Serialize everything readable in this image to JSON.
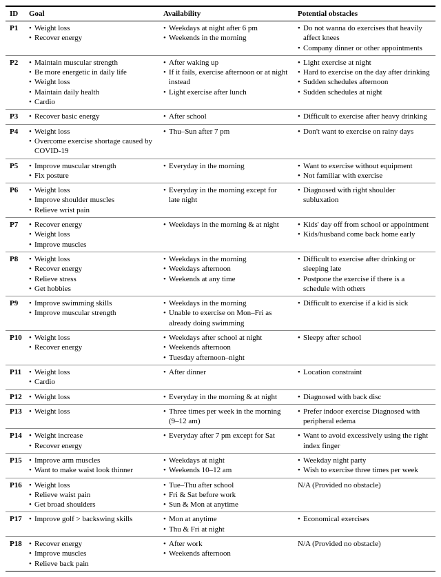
{
  "headers": {
    "id": "ID",
    "goal": "Goal",
    "availability": "Availability",
    "obstacles": "Potential obstacles"
  },
  "rows": [
    {
      "id": "P1",
      "goal": [
        "Weight loss",
        "Recover energy"
      ],
      "availability": [
        "Weekdays at night after 6 pm",
        "Weekends in the morning"
      ],
      "obstacles": [
        "Do not wanna do exercises that heavily affect knees",
        "Company dinner or other appointments"
      ]
    },
    {
      "id": "P2",
      "goal": [
        "Maintain muscular strength",
        "Be more energetic in daily life",
        "Weight loss",
        "Maintain daily health",
        "Cardio"
      ],
      "availability": [
        "After waking up",
        "If it fails, exercise afternoon or at night instead",
        "Light exercise after lunch"
      ],
      "obstacles": [
        "Light exercise at night",
        "Hard to exercise on the day after drinking",
        "Sudden schedules afternoon",
        "Sudden schedules at night"
      ]
    },
    {
      "id": "P3",
      "goal": [
        "Recover basic energy"
      ],
      "availability": [
        "After school"
      ],
      "obstacles": [
        "Difficult to exercise after heavy drinking"
      ]
    },
    {
      "id": "P4",
      "goal": [
        "Weight loss",
        "Overcome exercise shortage caused by COVID-19"
      ],
      "availability": [
        "Thu–Sun after 7 pm"
      ],
      "obstacles": [
        "Don't want to exercise on rainy days"
      ]
    },
    {
      "id": "P5",
      "goal": [
        "Improve muscular strength",
        "Fix posture"
      ],
      "availability": [
        "Everyday in the morning"
      ],
      "obstacles": [
        "Want to exercise without equipment",
        "Not familiar with exercise"
      ]
    },
    {
      "id": "P6",
      "goal": [
        "Weight loss",
        "Improve shoulder muscles",
        "Relieve wrist pain"
      ],
      "availability": [
        "Everyday in the morning except for late night"
      ],
      "obstacles": [
        "Diagnosed with right shoulder subluxation"
      ]
    },
    {
      "id": "P7",
      "goal": [
        "Recover energy",
        "Weight loss",
        "Improve muscles"
      ],
      "availability": [
        "Weekdays in the morning & at night"
      ],
      "obstacles": [
        "Kids' day off from school or appointment",
        "Kids/husband come back home early"
      ]
    },
    {
      "id": "P8",
      "goal": [
        "Weight loss",
        "Recover energy",
        "Relieve stress",
        "Get hobbies"
      ],
      "availability": [
        "Weekdays in the morning",
        "Weekdays afternoon",
        "Weekends at any time"
      ],
      "obstacles": [
        "Difficult to exercise after drinking or sleeping late",
        "Postpone the exercise if there is a schedule with others"
      ]
    },
    {
      "id": "P9",
      "goal": [
        "Improve swimming skills",
        "Improve muscular strength"
      ],
      "availability": [
        "Weekdays in the morning",
        "Unable to exercise on Mon–Fri as already doing swimming"
      ],
      "obstacles": [
        "Difficult to exercise if a kid is sick"
      ]
    },
    {
      "id": "P10",
      "goal": [
        "Weight loss",
        "Recover energy"
      ],
      "availability": [
        "Weekdays after school at night",
        "Weekends afternoon",
        "Tuesday afternoon–night"
      ],
      "obstacles": [
        "Sleepy after school"
      ]
    },
    {
      "id": "P11",
      "goal": [
        "Weight loss",
        "Cardio"
      ],
      "availability": [
        "After dinner"
      ],
      "obstacles": [
        "Location constraint"
      ]
    },
    {
      "id": "P12",
      "goal": [
        "Weight loss"
      ],
      "availability": [
        "Everyday in the morning & at night"
      ],
      "obstacles": [
        "Diagnosed with back disc"
      ]
    },
    {
      "id": "P13",
      "goal": [
        "Weight loss"
      ],
      "availability": [
        "Three times per week in the morning (9–12 am)"
      ],
      "obstacles": [
        "Prefer indoor exercise Diagnosed with peripheral edema"
      ]
    },
    {
      "id": "P14",
      "goal": [
        "Weight increase",
        "Recover energy"
      ],
      "availability": [
        "Everyday after 7 pm except for Sat"
      ],
      "obstacles": [
        "Want to avoid excessively using the right index finger"
      ]
    },
    {
      "id": "P15",
      "goal": [
        "Improve arm muscles",
        "Want to make waist look thinner"
      ],
      "availability": [
        "Weekdays at night",
        "Weekends 10–12 am"
      ],
      "obstacles": [
        "Weekday night party",
        "Wish to exercise three times per week"
      ]
    },
    {
      "id": "P16",
      "goal": [
        "Weight loss",
        "Relieve waist pain",
        "Get broad shoulders"
      ],
      "availability": [
        "Tue–Thu after school",
        "Fri & Sat before work",
        "Sun & Mon at anytime"
      ],
      "obstacles_plain": "N/A (Provided no obstacle)"
    },
    {
      "id": "P17",
      "goal": [
        "Improve golf > backswing skills"
      ],
      "availability": [
        "Mon at anytime",
        "Thu & Fri at night"
      ],
      "obstacles": [
        "Economical exercises"
      ]
    },
    {
      "id": "P18",
      "goal": [
        "Recover energy",
        "Improve muscles",
        "Relieve back pain"
      ],
      "availability": [
        "After work",
        "Weekends afternoon"
      ],
      "obstacles_plain": "N/A (Provided no obstacle)"
    }
  ]
}
